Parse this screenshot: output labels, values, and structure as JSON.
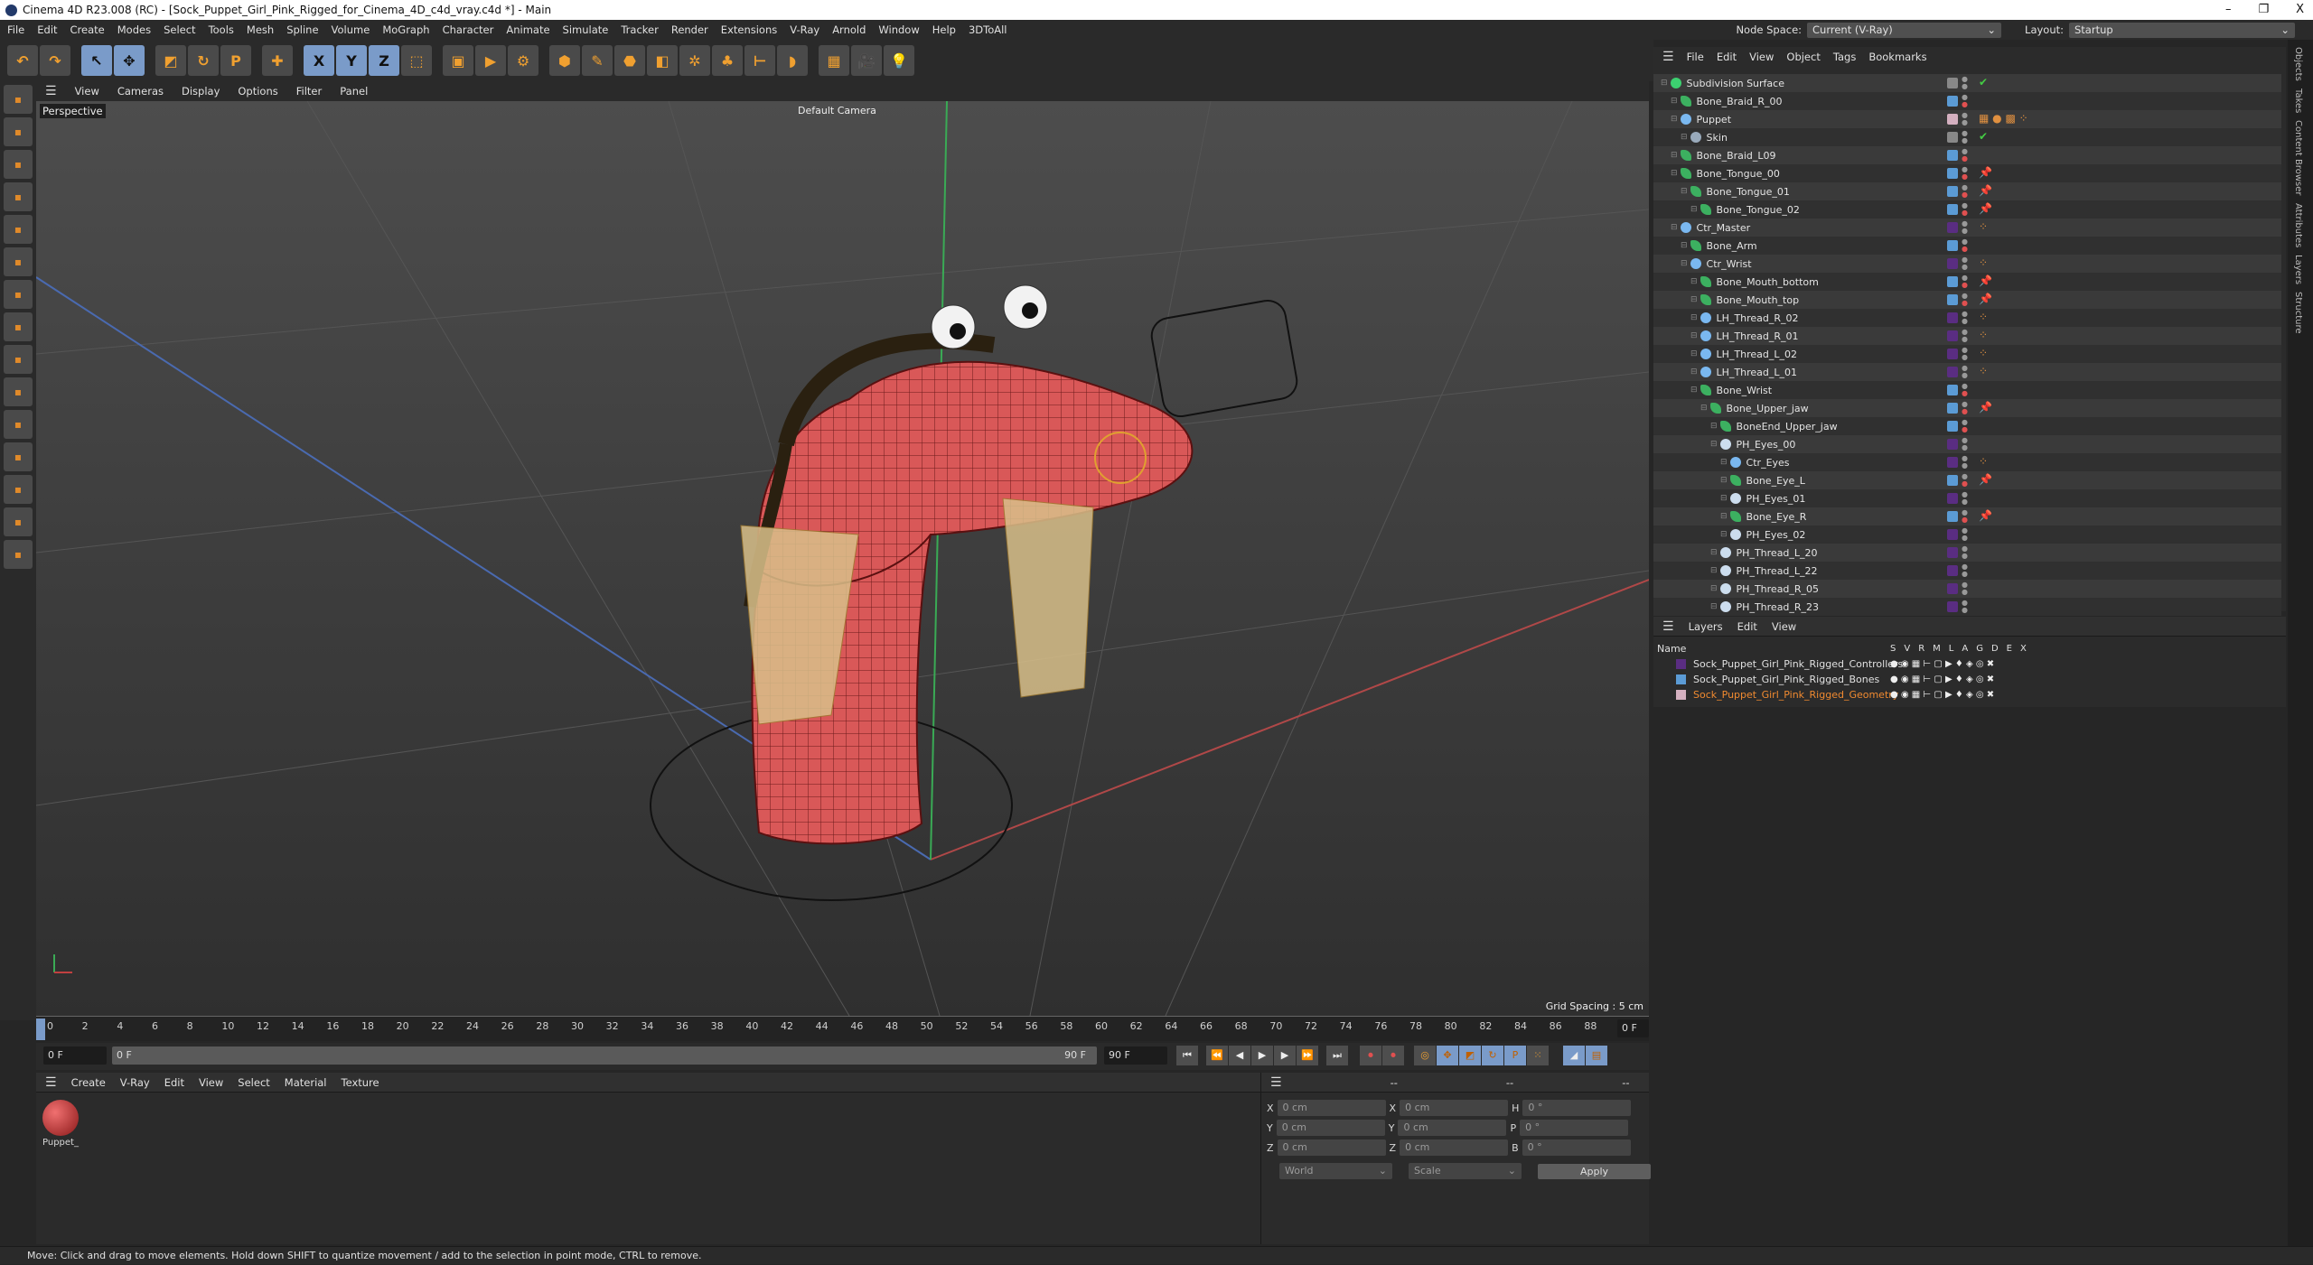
{
  "window": {
    "title": "Cinema 4D R23.008 (RC) - [Sock_Puppet_Girl_Pink_Rigged_for_Cinema_4D_c4d_vray.c4d *] - Main",
    "controls": [
      "–",
      "❐",
      "X"
    ]
  },
  "menu": [
    "File",
    "Edit",
    "Create",
    "Modes",
    "Select",
    "Tools",
    "Mesh",
    "Spline",
    "Volume",
    "MoGraph",
    "Character",
    "Animate",
    "Simulate",
    "Tracker",
    "Render",
    "Extensions",
    "V-Ray",
    "Arnold",
    "Window",
    "Help",
    "3DToAll"
  ],
  "nodespace": {
    "label": "Node Space:",
    "value": "Current (V-Ray)",
    "layout_label": "Layout:",
    "layout_value": "Startup"
  },
  "toolbar": [
    {
      "icon": "undo-icon",
      "g": "↶"
    },
    {
      "icon": "redo-icon",
      "g": "↷"
    },
    {
      "icon": "select-icon",
      "g": "↖",
      "sel": true
    },
    {
      "icon": "move-icon",
      "g": "✥",
      "sel": true
    },
    {
      "icon": "scale-icon",
      "g": "◩"
    },
    {
      "icon": "rotate-icon",
      "g": "↻"
    },
    {
      "icon": "psr-icon",
      "g": "P"
    },
    {
      "icon": "add-icon",
      "g": "✚"
    },
    {
      "icon": "x-axis-icon",
      "g": "X",
      "sel": true
    },
    {
      "icon": "y-axis-icon",
      "g": "Y",
      "sel": true
    },
    {
      "icon": "z-axis-icon",
      "g": "Z",
      "sel": true
    },
    {
      "icon": "coord-system-icon",
      "g": "⬚"
    },
    {
      "icon": "render-region-icon",
      "g": "▣"
    },
    {
      "icon": "render-view-icon",
      "g": "▶"
    },
    {
      "icon": "render-settings-icon",
      "g": "⚙"
    },
    {
      "icon": "cube-icon",
      "g": "⬢"
    },
    {
      "icon": "pen-icon",
      "g": "✎"
    },
    {
      "icon": "subdivision-icon",
      "g": "⬣"
    },
    {
      "icon": "extrude-icon",
      "g": "◧"
    },
    {
      "icon": "mograph-icon",
      "g": "✲"
    },
    {
      "icon": "cloner-icon",
      "g": "♣"
    },
    {
      "icon": "deformer-icon",
      "g": "⊢"
    },
    {
      "icon": "field-icon",
      "g": "◗"
    },
    {
      "icon": "floor-icon",
      "g": "▦"
    },
    {
      "icon": "camera-icon",
      "g": "🎥"
    },
    {
      "icon": "light-icon",
      "g": "💡"
    }
  ],
  "viewport": {
    "menu": [
      "View",
      "Cameras",
      "Display",
      "Options",
      "Filter",
      "Panel"
    ],
    "label": "Perspective",
    "camera": "Default Camera",
    "grid": "Grid Spacing : 5 cm"
  },
  "timeline": {
    "ticks": [
      0,
      2,
      4,
      6,
      8,
      10,
      12,
      14,
      16,
      18,
      20,
      22,
      24,
      26,
      28,
      30,
      32,
      34,
      36,
      38,
      40,
      42,
      44,
      46,
      48,
      50,
      52,
      54,
      56,
      58,
      60,
      62,
      64,
      66,
      68,
      70,
      72,
      74,
      76,
      78,
      80,
      82,
      84,
      86,
      88,
      90
    ],
    "current": "0 F",
    "start": "0 F",
    "range_start": "0 F",
    "range_end": "90 F",
    "end": "90 F"
  },
  "material": {
    "menu": [
      "Create",
      "V-Ray",
      "Edit",
      "View",
      "Select",
      "Material",
      "Texture"
    ],
    "items": [
      {
        "name": "Puppet_"
      }
    ]
  },
  "coords": {
    "headers": [
      "--",
      "--",
      "--"
    ],
    "rows": [
      [
        "X",
        "0 cm",
        "X",
        "0 cm",
        "H",
        "0 °"
      ],
      [
        "Y",
        "0 cm",
        "Y",
        "0 cm",
        "P",
        "0 °"
      ],
      [
        "Z",
        "0 cm",
        "Z",
        "0 cm",
        "B",
        "0 °"
      ]
    ],
    "mode": "World",
    "scale": "Scale",
    "apply": "Apply"
  },
  "objects": {
    "menu": [
      "File",
      "Edit",
      "View",
      "Object",
      "Tags",
      "Bookmarks"
    ],
    "rows": [
      {
        "name": "Subdivision Surface",
        "d": 0,
        "t": "sub",
        "c": "#888",
        "tags": "✔"
      },
      {
        "name": "Bone_Braid_R_00",
        "d": 1,
        "t": "bone",
        "c": "#5b9bd5"
      },
      {
        "name": "Puppet",
        "d": 1,
        "t": "null",
        "c": "#d4b0c0",
        "tags": "▦ ● ▩ ⁘"
      },
      {
        "name": "Skin",
        "d": 2,
        "t": "skin",
        "c": "#888",
        "tags": "✔"
      },
      {
        "name": "Bone_Braid_L09",
        "d": 1,
        "t": "bone",
        "c": "#5b9bd5"
      },
      {
        "name": "Bone_Tongue_00",
        "d": 1,
        "t": "bone",
        "c": "#5b9bd5",
        "tags": "📌"
      },
      {
        "name": "Bone_Tongue_01",
        "d": 2,
        "t": "bone",
        "c": "#5b9bd5",
        "tags": "📌"
      },
      {
        "name": "Bone_Tongue_02",
        "d": 3,
        "t": "bone",
        "c": "#5b9bd5",
        "tags": "📌"
      },
      {
        "name": "Ctr_Master",
        "d": 1,
        "t": "null",
        "c": "#5a2d82",
        "tags": "⁘"
      },
      {
        "name": "Bone_Arm",
        "d": 2,
        "t": "bone",
        "c": "#5b9bd5"
      },
      {
        "name": "Ctr_Wrist",
        "d": 2,
        "t": "null",
        "c": "#5a2d82",
        "tags": "⁘"
      },
      {
        "name": "Bone_Mouth_bottom",
        "d": 3,
        "t": "bone",
        "c": "#5b9bd5",
        "tags": "📌"
      },
      {
        "name": "Bone_Mouth_top",
        "d": 3,
        "t": "bone",
        "c": "#5b9bd5",
        "tags": "📌"
      },
      {
        "name": "LH_Thread_R_02",
        "d": 3,
        "t": "null",
        "c": "#5a2d82",
        "tags": "⁘"
      },
      {
        "name": "LH_Thread_R_01",
        "d": 3,
        "t": "null",
        "c": "#5a2d82",
        "tags": "⁘"
      },
      {
        "name": "LH_Thread_L_02",
        "d": 3,
        "t": "null",
        "c": "#5a2d82",
        "tags": "⁘"
      },
      {
        "name": "LH_Thread_L_01",
        "d": 3,
        "t": "null",
        "c": "#5a2d82",
        "tags": "⁘"
      },
      {
        "name": "Bone_Wrist",
        "d": 3,
        "t": "bone",
        "c": "#5b9bd5"
      },
      {
        "name": "Bone_Upper_jaw",
        "d": 4,
        "t": "bone",
        "c": "#5b9bd5",
        "tags": "📌"
      },
      {
        "name": "BoneEnd_Upper_jaw",
        "d": 5,
        "t": "bone",
        "c": "#5b9bd5"
      },
      {
        "name": "PH_Eyes_00",
        "d": 5,
        "t": "ph",
        "c": "#5a2d82"
      },
      {
        "name": "Ctr_Eyes",
        "d": 6,
        "t": "null",
        "c": "#5a2d82",
        "tags": "⁘"
      },
      {
        "name": "Bone_Eye_L",
        "d": 6,
        "t": "bone",
        "c": "#5b9bd5",
        "tags": "📌"
      },
      {
        "name": "PH_Eyes_01",
        "d": 6,
        "t": "ph",
        "c": "#5a2d82"
      },
      {
        "name": "Bone_Eye_R",
        "d": 6,
        "t": "bone",
        "c": "#5b9bd5",
        "tags": "📌"
      },
      {
        "name": "PH_Eyes_02",
        "d": 6,
        "t": "ph",
        "c": "#5a2d82"
      },
      {
        "name": "PH_Thread_L_20",
        "d": 5,
        "t": "ph",
        "c": "#5a2d82"
      },
      {
        "name": "PH_Thread_L_22",
        "d": 5,
        "t": "ph",
        "c": "#5a2d82"
      },
      {
        "name": "PH_Thread_R_05",
        "d": 5,
        "t": "ph",
        "c": "#5a2d82"
      },
      {
        "name": "PH_Thread_R_23",
        "d": 5,
        "t": "ph",
        "c": "#5a2d82"
      }
    ]
  },
  "layers": {
    "menu": [
      "Layers",
      "Edit",
      "View"
    ],
    "name_header": "Name",
    "columns": [
      "S",
      "V",
      "R",
      "M",
      "L",
      "A",
      "G",
      "D",
      "E",
      "X"
    ],
    "rows": [
      {
        "name": "Sock_Puppet_Girl_Pink_Rigged_Controllers",
        "c": "#5a2d82",
        "active": false
      },
      {
        "name": "Sock_Puppet_Girl_Pink_Rigged_Bones",
        "c": "#5b9bd5",
        "active": false
      },
      {
        "name": "Sock_Puppet_Girl_Pink_Rigged_Geometry",
        "c": "#d4b0c0",
        "active": true
      }
    ]
  },
  "right_tabs": [
    "Objects",
    "Takes",
    "Content Browser",
    "Attributes",
    "Layers",
    "Structure"
  ],
  "status": "Move: Click and drag to move elements. Hold down SHIFT to quantize movement / add to the selection in point mode, CTRL to remove.",
  "colors": {
    "accent": "#7a9bc9",
    "orange": "#f0a030",
    "active_layer": "#f08a30"
  }
}
